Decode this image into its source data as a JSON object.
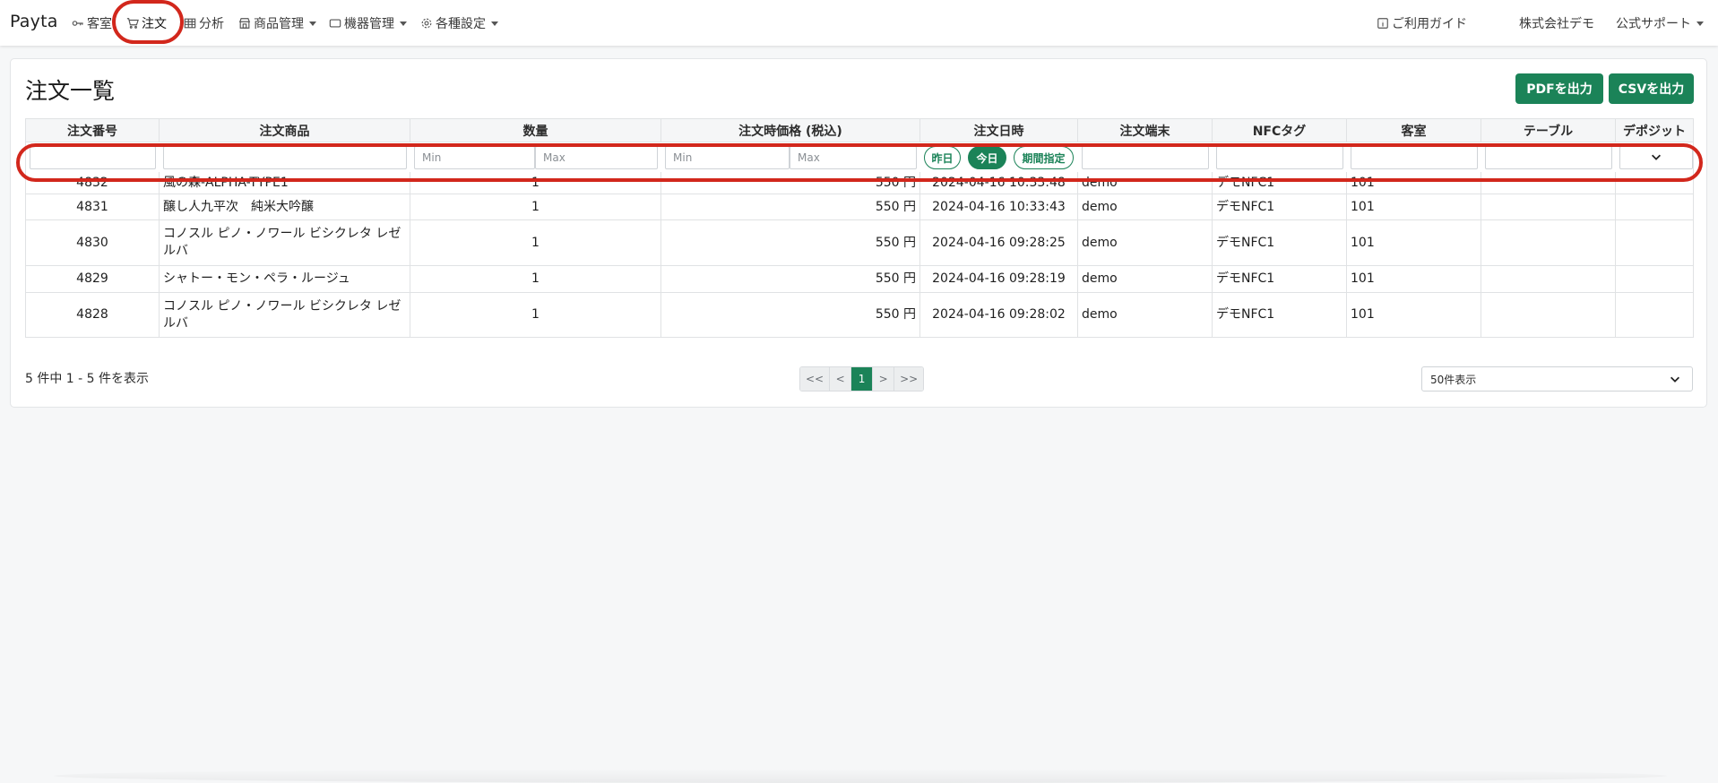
{
  "nav": {
    "brand": "Payta",
    "items": [
      {
        "label": "客室",
        "icon": "key-icon",
        "dropdown": false
      },
      {
        "label": "注文",
        "icon": "cart-icon",
        "dropdown": false,
        "active": true
      },
      {
        "label": "分析",
        "icon": "table-icon",
        "dropdown": false
      },
      {
        "label": "商品管理",
        "icon": "shop-icon",
        "dropdown": true
      },
      {
        "label": "機器管理",
        "icon": "tablet-icon",
        "dropdown": true
      },
      {
        "label": "各種設定",
        "icon": "gear-icon",
        "dropdown": true
      }
    ],
    "guide": "ご利用ガイド",
    "guide_icon": "info-icon",
    "company": "株式会社デモ",
    "support": "公式サポート"
  },
  "page": {
    "title": "注文一覧",
    "pdf_button": "PDFを出力",
    "csv_button": "CSVを出力"
  },
  "table": {
    "columns": [
      "注文番号",
      "注文商品",
      "数量",
      "注文時価格 (税込)",
      "注文日時",
      "注文端末",
      "NFCタグ",
      "客室",
      "テーブル",
      "デポジット"
    ],
    "filters": {
      "qty_min": "Min",
      "qty_max": "Max",
      "price_min": "Min",
      "price_max": "Max",
      "date_yesterday": "昨日",
      "date_today": "今日",
      "date_range": "期間指定"
    },
    "rows": [
      {
        "id": "4832",
        "product": "風の森-ALPHA-TYPE1",
        "qty": "1",
        "price": "550 円",
        "datetime": "2024-04-16 10:33:48",
        "terminal": "demo",
        "nfc": "デモNFC1",
        "room": "101",
        "table": "",
        "deposit": ""
      },
      {
        "id": "4831",
        "product": "醸し人九平次　純米大吟醸",
        "qty": "1",
        "price": "550 円",
        "datetime": "2024-04-16 10:33:43",
        "terminal": "demo",
        "nfc": "デモNFC1",
        "room": "101",
        "table": "",
        "deposit": ""
      },
      {
        "id": "4830",
        "product": "コノスル ピノ・ノワール ビシクレタ レゼルバ",
        "qty": "1",
        "price": "550 円",
        "datetime": "2024-04-16 09:28:25",
        "terminal": "demo",
        "nfc": "デモNFC1",
        "room": "101",
        "table": "",
        "deposit": ""
      },
      {
        "id": "4829",
        "product": "シャトー・モン・ペラ・ルージュ",
        "qty": "1",
        "price": "550 円",
        "datetime": "2024-04-16 09:28:19",
        "terminal": "demo",
        "nfc": "デモNFC1",
        "room": "101",
        "table": "",
        "deposit": ""
      },
      {
        "id": "4828",
        "product": "コノスル ピノ・ノワール ビシクレタ レゼルバ",
        "qty": "1",
        "price": "550 円",
        "datetime": "2024-04-16 09:28:02",
        "terminal": "demo",
        "nfc": "デモNFC1",
        "room": "101",
        "table": "",
        "deposit": ""
      }
    ]
  },
  "footer": {
    "info": "5 件中 1 - 5 件を表示",
    "pager": [
      "<<",
      "<",
      "1",
      ">",
      ">>"
    ],
    "active_page": "1",
    "per_page": "50件表示"
  },
  "colors": {
    "accent": "#1b8358",
    "highlight": "#d2271c"
  }
}
